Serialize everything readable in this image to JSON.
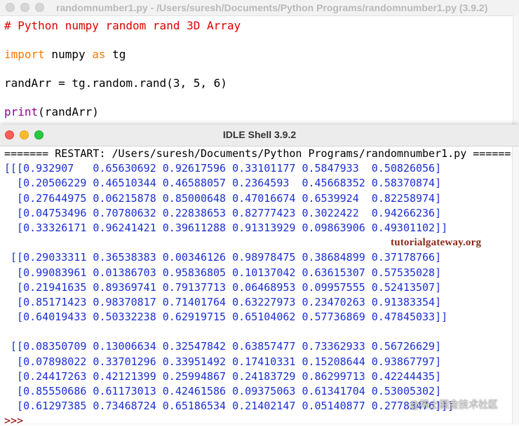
{
  "editor": {
    "title": "randomnumber1.py - /Users/suresh/Documents/Python Programs/randomnumber1.py (3.9.2)",
    "comment": "# Python numpy random rand 3D Array",
    "import_kw": "import",
    "import_mid": " numpy ",
    "as_kw": "as",
    "import_tail": " tg",
    "assign": "randArr = tg.random.rand(3, 5, 6)",
    "print_fn": "print",
    "print_args": "(randArr)"
  },
  "shell": {
    "title": "IDLE Shell 3.9.2",
    "restart": "======= RESTART: /Users/suresh/Documents/Python Programs/randomnumber1.py ======",
    "output": [
      "[[[0.932907   0.65630692 0.92617596 0.33101177 0.5847933  0.50826056]",
      "  [0.20506229 0.46510344 0.46588057 0.2364593  0.45668352 0.58370874]",
      "  [0.27644975 0.06215878 0.85000648 0.47016674 0.6539924  0.82258974]",
      "  [0.04753496 0.70780632 0.22838653 0.82777423 0.3022422  0.94266236]",
      "  [0.33326171 0.96241421 0.39611288 0.91313929 0.09863906 0.49301102]]",
      "",
      " [[0.29033311 0.36538383 0.00346126 0.98978475 0.38684899 0.37178766]",
      "  [0.99083961 0.01386703 0.95836805 0.10137042 0.63615307 0.57535028]",
      "  [0.21941635 0.89369741 0.79137713 0.06468953 0.09957555 0.52413507]",
      "  [0.85171423 0.98370817 0.71401764 0.63227973 0.23470263 0.91383354]",
      "  [0.64019433 0.50332238 0.62919715 0.65104062 0.57736869 0.47845033]]",
      "",
      " [[0.08350709 0.13006634 0.32547842 0.63857477 0.73362933 0.56726629]",
      "  [0.07898022 0.33701296 0.33951492 0.17410331 0.15208644 0.93867797]",
      "  [0.24417263 0.42121399 0.25994867 0.24183729 0.86299713 0.42244435]",
      "  [0.85550686 0.61173013 0.42461586 0.09375063 0.61341704 0.53005302]",
      "  [0.61297385 0.73468724 0.65186534 0.21402147 0.05140877 0.27783476]]]"
    ],
    "prompt": ">>> "
  },
  "watermark": "tutorialgateway.org",
  "corner_watermark": "@稀土掘金技术社区",
  "colors": {
    "comment": "#dd0000",
    "keyword": "#ff7700",
    "builtin": "#900090",
    "output": "#1a2fd2",
    "close": "#ff5f57",
    "minimize": "#febc2e",
    "zoom": "#28c840"
  }
}
